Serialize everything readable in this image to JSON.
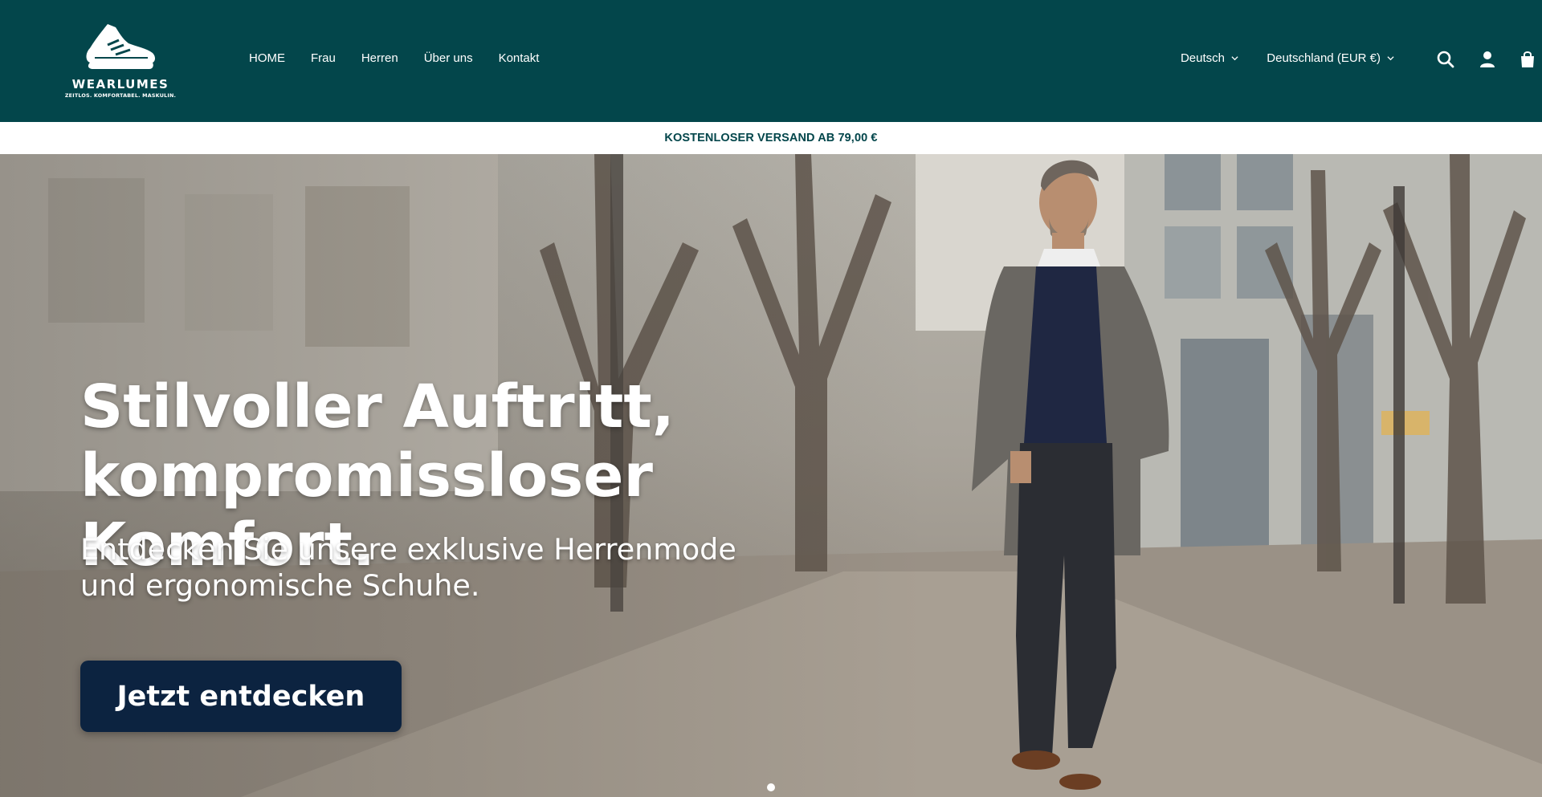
{
  "brand": {
    "name": "WEARLUMES",
    "tagline": "ZEITLOS. KOMFORTABEL. MASKULIN."
  },
  "nav": {
    "items": [
      {
        "label": "HOME"
      },
      {
        "label": "Frau"
      },
      {
        "label": "Herren"
      },
      {
        "label": "Über uns"
      },
      {
        "label": "Kontakt"
      }
    ]
  },
  "header_tools": {
    "language": "Deutsch",
    "country": "Deutschland (EUR €)",
    "icons": [
      "search-icon",
      "account-icon",
      "cart-icon"
    ]
  },
  "announcement": {
    "text": "KOSTENLOSER VERSAND AB 79,00 €"
  },
  "hero": {
    "title_line1": "Stilvoller Auftritt,",
    "title_line2": "kompromissloser Komfort.",
    "subtitle_line1": "Entdecken Sie unsere exklusive Herrenmode",
    "subtitle_line2": "und ergonomische Schuhe.",
    "cta_label": "Jetzt entdecken",
    "slides_total": 1,
    "active_slide": 1
  },
  "colors": {
    "header_bg": "#03464b",
    "announcement_text": "#03464b",
    "cta_bg": "#0c2340"
  }
}
